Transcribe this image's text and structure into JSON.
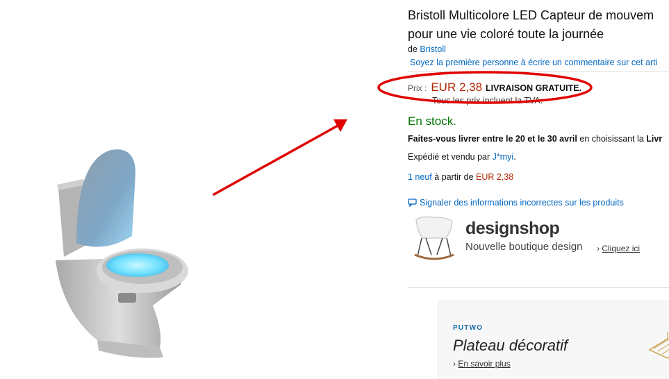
{
  "product": {
    "title_line1": "Bristoll Multicolore LED Capteur de mouvem",
    "title_line2": "pour une vie coloré toute la journée",
    "by_prefix": "de ",
    "brand": "Bristoll",
    "review_link": "Soyez la première personne à écrire un commentaire sur cet arti",
    "price_label": "Prix :",
    "price": "EUR 2,38",
    "free_shipping": "LIVRAISON GRATUITE.",
    "vat_note": "Tous les prix incluent la TVA.",
    "stock": "En stock.",
    "delivery_prefix": "Faites-vous livrer entre le 20 et le 30 avril",
    "delivery_suffix": " en choisissant la ",
    "delivery_cut": "Livr",
    "shipped_prefix": "Expédié et vendu par ",
    "seller": "J*myi",
    "shipped_suffix": ".",
    "offers_link": "1 neuf",
    "offers_middle": " à partir de ",
    "offers_price": "EUR 2,38",
    "report_link": "Signaler des informations incorrectes sur les produits"
  },
  "ads": {
    "designshop": {
      "logo": "designshop",
      "tagline": "Nouvelle boutique design",
      "cta": "Cliquez ici"
    },
    "putwo": {
      "brand": "PUTWO",
      "headline": "Plateau décoratif",
      "cta": "En savoir plus"
    }
  },
  "icons": [
    "arrow-annotation",
    "price-highlight-ellipse",
    "report-comment-icon",
    "chair-image",
    "tray-image",
    "toilet-led-image"
  ],
  "colors": {
    "price": "#b12704",
    "link": "#0066c0",
    "in_stock": "#007600",
    "annotation": "#e00000",
    "led_glow": "#6fe0ff"
  }
}
